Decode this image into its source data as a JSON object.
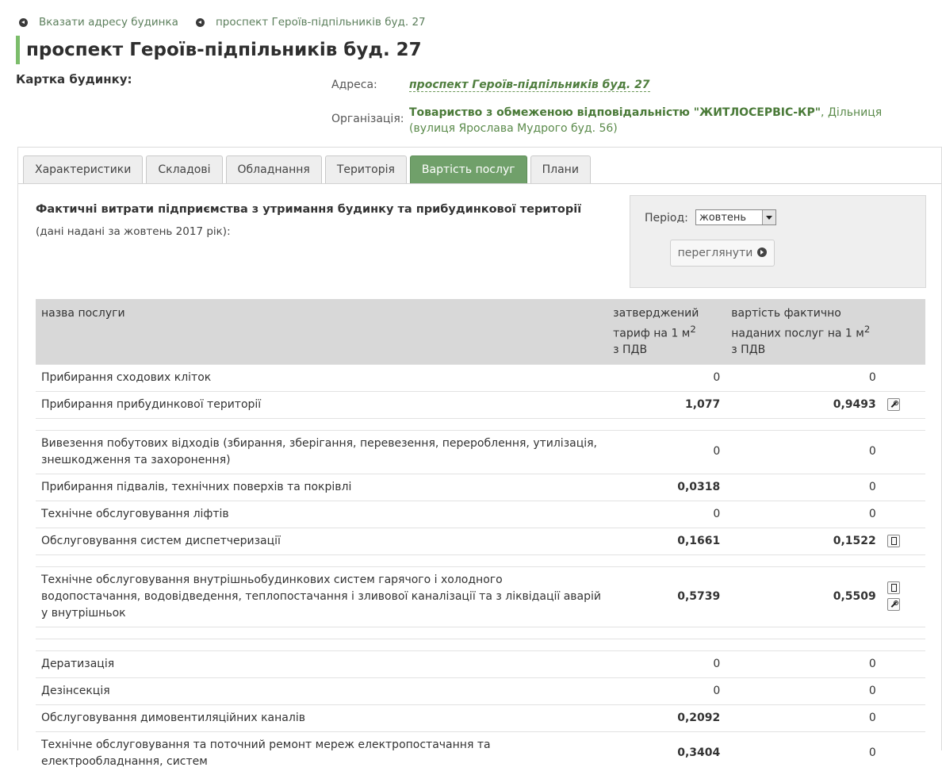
{
  "breadcrumbs": [
    "Вказати адресу будинка",
    "проспект Героїв-підпільників буд. 27"
  ],
  "page_title": "проспект Героїв-підпільників буд. 27",
  "card_label": "Картка будинку:",
  "address": {
    "label": "Адреса:",
    "value": "проспект Героїв-підпільників буд. 27"
  },
  "organization": {
    "label": "Організація:",
    "name": "Товариство з обмеженою відповідальністю \"ЖИТЛОСЕРВІС-КР\"",
    "rest": ", Дільниця (вулиця Ярослава Мудрого буд. 56)"
  },
  "tabs": [
    {
      "label": "Характеристики",
      "active": false
    },
    {
      "label": "Складові",
      "active": false
    },
    {
      "label": "Обладнання",
      "active": false
    },
    {
      "label": "Територія",
      "active": false
    },
    {
      "label": "Вартість послуг",
      "active": true
    },
    {
      "label": "Плани",
      "active": false
    }
  ],
  "section": {
    "heading": "Фактичні витрати підприємства з утримання будинку та прибудинкової території",
    "subheading": "(дані надані за жовтень 2017 рік):"
  },
  "period": {
    "label": "Період:",
    "selected": "жовтень",
    "button": "переглянути"
  },
  "table": {
    "headers": {
      "name": "назва послуги",
      "tariff_pre": "затверджений тариф на 1 м",
      "tariff_post": "з ПДВ",
      "actual_pre": "вартість фактично наданих послуг на 1 м",
      "actual_post": "з ПДВ",
      "sup": "2"
    },
    "rows": [
      {
        "name": "Прибирання сходових кліток",
        "tariff": "0",
        "actual": "0",
        "icons": []
      },
      {
        "name": "Прибирання прибудинкової території",
        "tariff": "1,077",
        "actual": "0,9493",
        "icons": [
          "wrench"
        ]
      },
      {
        "spacer": true
      },
      {
        "name": "Вивезення побутових відходів (збирання, зберігання, перевезення, перероблення, утилізація, знешкодження та захоронення)",
        "tariff": "0",
        "actual": "0",
        "icons": []
      },
      {
        "name": "Прибирання підвалів, технічних поверхів та покрівлі",
        "tariff": "0,0318",
        "actual": "0",
        "icons": []
      },
      {
        "name": "Технічне обслуговування ліфтів",
        "tariff": "0",
        "actual": "0",
        "icons": []
      },
      {
        "name": "Обслуговування систем диспетчеризації",
        "tariff": "0,1661",
        "actual": "0,1522",
        "icons": [
          "doc"
        ]
      },
      {
        "spacer": true
      },
      {
        "name": "Технічне обслуговування внутрішньобудинкових систем гарячого і холодного водопостачання, водовідведення, теплопостачання і зливової каналізації та з ліквідації аварій у внутрішньок",
        "tariff": "0,5739",
        "actual": "0,5509",
        "icons": [
          "doc",
          "wrench"
        ]
      },
      {
        "spacer": true
      },
      {
        "spacer": true
      },
      {
        "name": "Дератизація",
        "tariff": "0",
        "actual": "0",
        "icons": []
      },
      {
        "name": "Дезінсекція",
        "tariff": "0",
        "actual": "0",
        "icons": []
      },
      {
        "name": "Обслуговування димовентиляційних каналів",
        "tariff": "0,2092",
        "actual": "0",
        "icons": []
      },
      {
        "name": "Технічне обслуговування та поточний ремонт мереж електропостачання та електрообладнання, систем",
        "tariff": "0,3404",
        "actual": "0",
        "icons": []
      }
    ]
  }
}
